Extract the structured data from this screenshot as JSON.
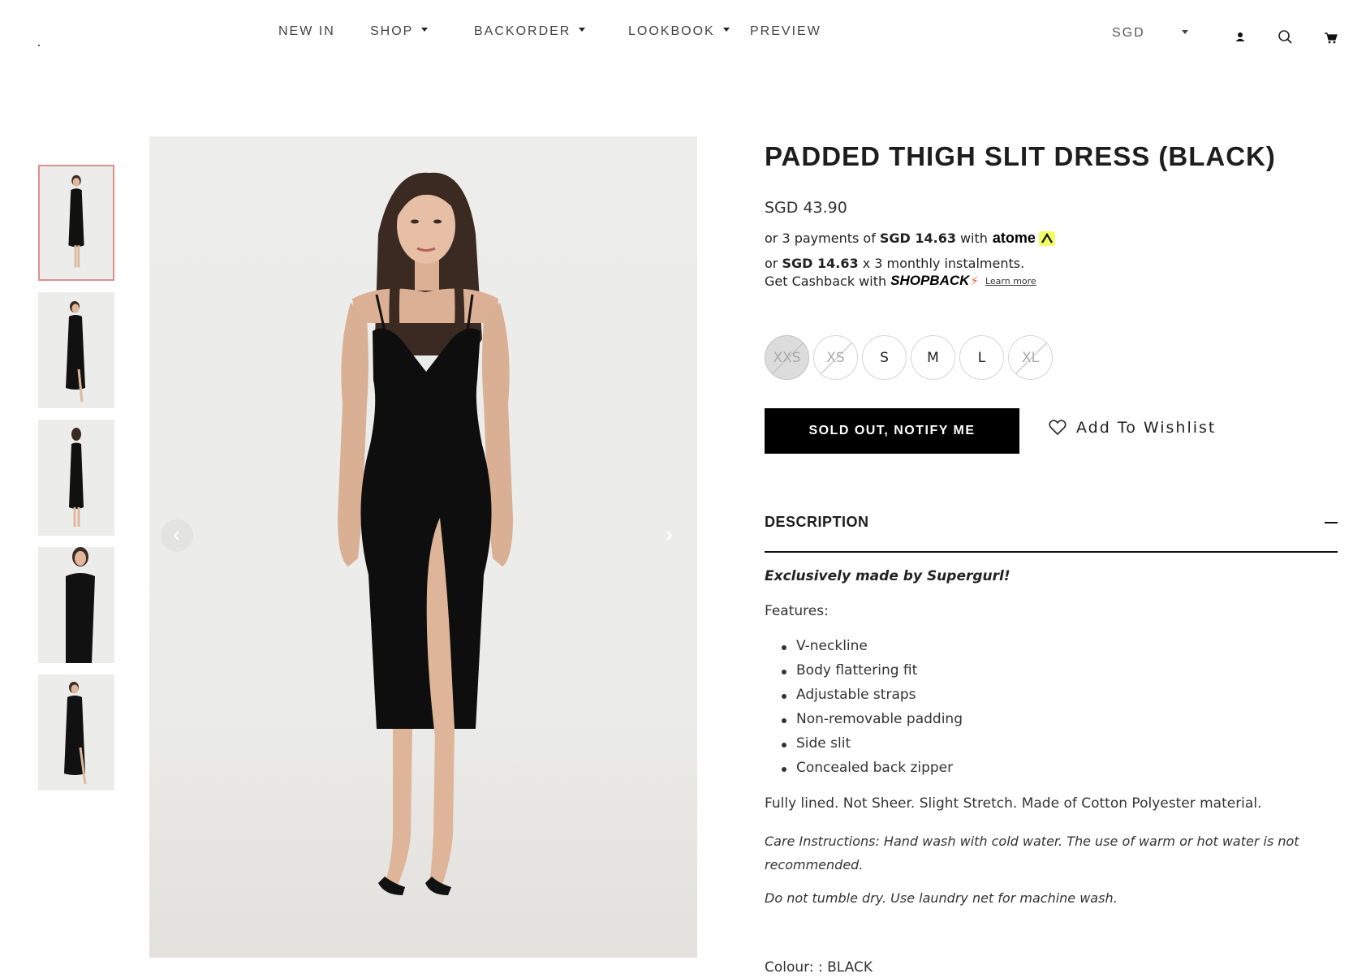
{
  "header": {
    "nav": [
      {
        "label": "NEW IN",
        "caret": false
      },
      {
        "label": "SHOP",
        "caret": true
      },
      {
        "label": "BACKORDER",
        "caret": true
      },
      {
        "label": "LOOKBOOK",
        "caret": true
      },
      {
        "label": "PREVIEW",
        "caret": false
      }
    ],
    "currency": "SGD",
    "icons": [
      "account-icon",
      "search-icon",
      "cart-icon"
    ]
  },
  "gallery": {
    "thumbnail_count": 5,
    "active_index": 0
  },
  "product": {
    "title": "PADDED THIGH SLIT DRESS (BLACK)",
    "price": "SGD 43.90",
    "atome": {
      "prefix": "or 3 payments of",
      "amount": "SGD 14.63",
      "suffix": "with",
      "brand": "atome"
    },
    "shopback": {
      "prefix": "or",
      "amount": "SGD 14.63",
      "suffix": "x 3 monthly instalments.",
      "cashback_label": "Get Cashback with",
      "brand": "SHOPBACK",
      "learn_more": "Learn more"
    },
    "sizes": [
      {
        "label": "XXS",
        "sold_out": true,
        "selected": true
      },
      {
        "label": "XS",
        "sold_out": true,
        "selected": false
      },
      {
        "label": "S",
        "sold_out": false,
        "selected": false
      },
      {
        "label": "M",
        "sold_out": false,
        "selected": false
      },
      {
        "label": "L",
        "sold_out": false,
        "selected": false
      },
      {
        "label": "XL",
        "sold_out": true,
        "selected": false
      }
    ],
    "notify_button": "SOLD OUT, NOTIFY ME",
    "wishlist_label": "Add To Wishlist"
  },
  "description": {
    "heading": "DESCRIPTION",
    "exclusive": "Exclusively made by Supergurl!",
    "features_label": "Features:",
    "features": [
      "V-neckline",
      "Body flattering fit",
      "Adjustable straps",
      "Non-removable padding",
      "Side slit",
      "Concealed back zipper"
    ],
    "material": "Fully lined. Not Sheer. Slight Stretch. Made of Cotton Polyester material.",
    "care": "Care Instructions: Hand wash with cold water. The use of warm or hot water is not recommended.",
    "tumble": "Do not tumble dry. Use laundry net for machine wash.",
    "colour": "Colour: : BLACK"
  },
  "colors": {
    "accent_border": "#e08f8f",
    "button_bg": "#000000",
    "atome_badge": "#f0ff5f",
    "shopback_bolt": "#ff5a3c"
  }
}
